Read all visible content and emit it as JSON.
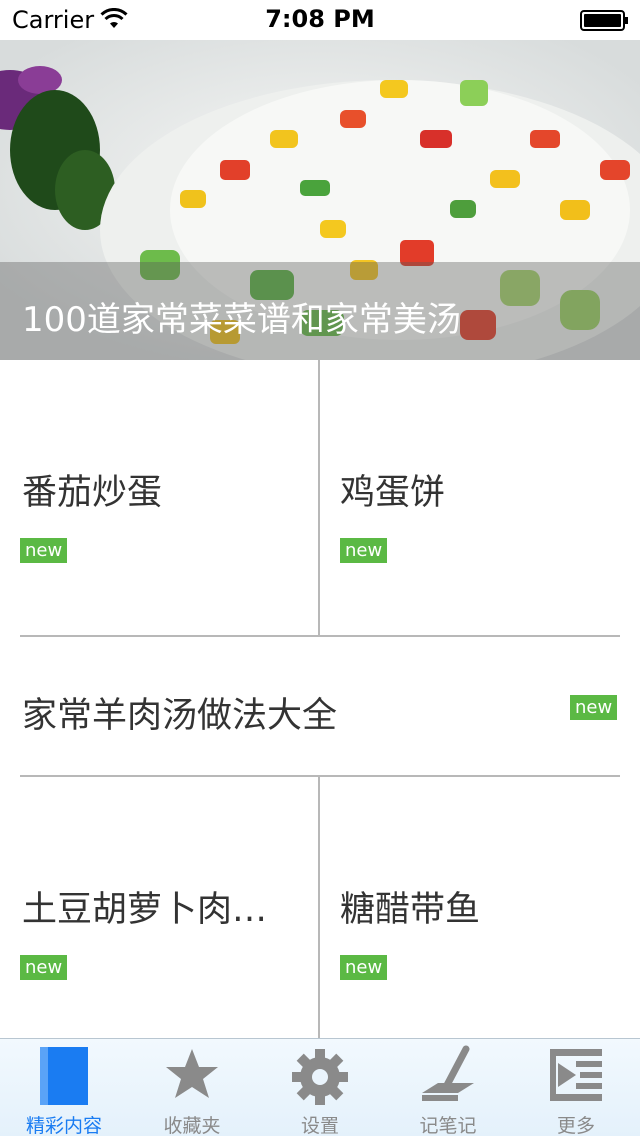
{
  "status_bar": {
    "carrier": "Carrier",
    "time": "7:08 PM"
  },
  "hero": {
    "title": "100道家常菜菜谱和家常美汤"
  },
  "items": [
    {
      "title": "番茄炒蛋",
      "badge": "new"
    },
    {
      "title": "鸡蛋饼",
      "badge": "new"
    },
    {
      "title": "家常羊肉汤做法大全",
      "badge": "new"
    },
    {
      "title": "土豆胡萝卜肉…",
      "badge": "new"
    },
    {
      "title": "糖醋带鱼",
      "badge": "new"
    }
  ],
  "tab_bar": {
    "tabs": [
      {
        "label": "精彩内容",
        "icon": "bookmark-icon",
        "active": true
      },
      {
        "label": "收藏夹",
        "icon": "star-icon",
        "active": false
      },
      {
        "label": "设置",
        "icon": "gear-icon",
        "active": false
      },
      {
        "label": "记笔记",
        "icon": "pen-note-icon",
        "active": false
      },
      {
        "label": "更多",
        "icon": "more-list-icon",
        "active": false
      }
    ]
  },
  "colors": {
    "badge_green": "#5bb944",
    "active_tab": "#1a7cf2",
    "inactive_tab": "#8a8a8a"
  }
}
